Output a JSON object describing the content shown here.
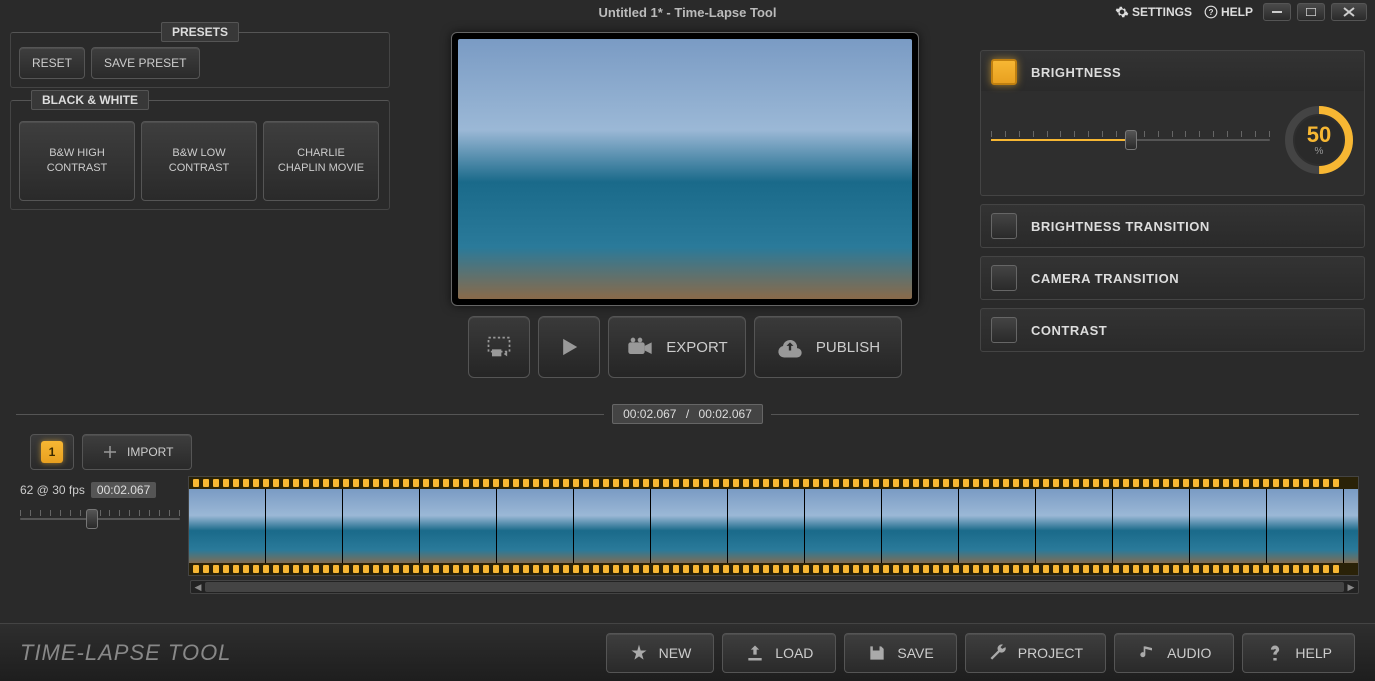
{
  "title": "Untitled 1* - Time-Lapse Tool",
  "top_links": {
    "settings": "SETTINGS",
    "help": "HELP"
  },
  "presets": {
    "legend": "PRESETS",
    "reset": "RESET",
    "save": "SAVE PRESET",
    "bw_legend": "BLACK & WHITE",
    "items": [
      "B&W HIGH CONTRAST",
      "B&W LOW CONTRAST",
      "CHARLIE CHAPLIN MOVIE"
    ]
  },
  "actions": {
    "export": "EXPORT",
    "publish": "PUBLISH"
  },
  "effects": {
    "brightness": {
      "label": "BRIGHTNESS",
      "value": "50",
      "unit": "%"
    },
    "items": [
      "BRIGHTNESS TRANSITION",
      "CAMERA TRANSITION",
      "CONTRAST"
    ]
  },
  "time": {
    "current": "00:02.067",
    "total": "00:02.067",
    "sep": "/"
  },
  "tabs": {
    "active": "1",
    "import": "IMPORT"
  },
  "timeline": {
    "fps_info": "62 @ 30 fps",
    "duration": "00:02.067"
  },
  "bottom": {
    "logo": "TIME-LAPSE TOOL",
    "new": "NEW",
    "load": "LOAD",
    "save": "SAVE",
    "project": "PROJECT",
    "audio": "AUDIO",
    "help": "HELP"
  }
}
